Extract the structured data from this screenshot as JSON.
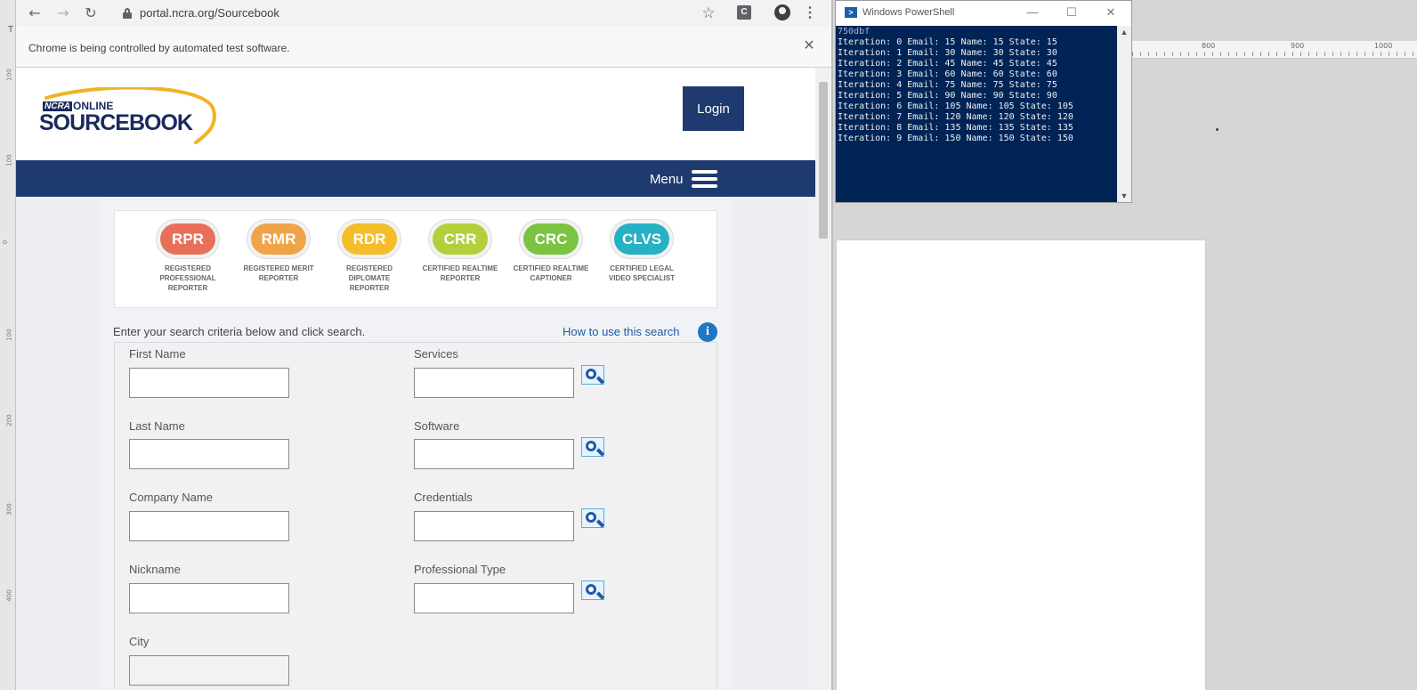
{
  "background_app": {
    "corner_letter": "T",
    "top_ruler_labels": [
      "800",
      "900",
      "1000"
    ],
    "left_ruler_labels": [
      "100",
      "0",
      "100",
      "100",
      "200",
      "300",
      "400"
    ]
  },
  "browser": {
    "url": "portal.ncra.org/Sourcebook",
    "infobar_text": "Chrome is being controlled by automated test software.",
    "icons": {
      "back": "back-arrow-icon",
      "forward": "forward-arrow-icon",
      "reload": "reload-icon",
      "lock": "lock-icon",
      "bookmark": "star-icon",
      "extension": "extension-icon",
      "profile": "profile-icon",
      "menu": "kebab-menu-icon",
      "close": "close-icon"
    },
    "extension_letter": "C"
  },
  "site": {
    "logo": {
      "ncra": "NCRA",
      "online": "ONLINE",
      "sourcebook": "SOURCEBOOK"
    },
    "login_label": "Login",
    "menu_label": "Menu",
    "colors": {
      "navy": "#1f3a6e",
      "link": "#1f5aa6",
      "logo_gold": "#f0b323"
    },
    "credentials": [
      {
        "code": "RPR",
        "desc": "REGISTERED PROFESSIONAL REPORTER",
        "color": "#e8705a"
      },
      {
        "code": "RMR",
        "desc": "REGISTERED MERIT REPORTER",
        "color": "#f0a44a"
      },
      {
        "code": "RDR",
        "desc": "REGISTERED DIPLOMATE REPORTER",
        "color": "#f4bd2a"
      },
      {
        "code": "CRR",
        "desc": "CERTIFIED REALTIME REPORTER",
        "color": "#b3cf3c"
      },
      {
        "code": "CRC",
        "desc": "CERTIFIED REALTIME CAPTIONER",
        "color": "#7cc243"
      },
      {
        "code": "CLVS",
        "desc": "CERTIFIED LEGAL VIDEO SPECIALIST",
        "color": "#27b1c4"
      }
    ],
    "search_intro": "Enter your search criteria below and click search.",
    "how_to_link": "How to use this search",
    "form": {
      "first_name": {
        "label": "First Name",
        "value": ""
      },
      "last_name": {
        "label": "Last Name",
        "value": ""
      },
      "company_name": {
        "label": "Company Name",
        "value": ""
      },
      "nickname": {
        "label": "Nickname",
        "value": ""
      },
      "city": {
        "label": "City",
        "value": ""
      },
      "services": {
        "label": "Services",
        "value": ""
      },
      "software": {
        "label": "Software",
        "value": ""
      },
      "credentials": {
        "label": "Credentials",
        "value": ""
      },
      "professional_type": {
        "label": "Professional Type",
        "value": ""
      }
    }
  },
  "powershell": {
    "title": "Windows PowerShell",
    "colors": {
      "console_bg": "#012456"
    },
    "lines": [
      "750dbf",
      "Iteration: 0 Email: 15 Name: 15 State: 15",
      "Iteration: 1 Email: 30 Name: 30 State: 30",
      "Iteration: 2 Email: 45 Name: 45 State: 45",
      "Iteration: 3 Email: 60 Name: 60 State: 60",
      "Iteration: 4 Email: 75 Name: 75 State: 75",
      "Iteration: 5 Email: 90 Name: 90 State: 90",
      "Iteration: 6 Email: 105 Name: 105 State: 105",
      "Iteration: 7 Email: 120 Name: 120 State: 120",
      "Iteration: 8 Email: 135 Name: 135 State: 135",
      "Iteration: 9 Email: 150 Name: 150 State: 150"
    ]
  }
}
